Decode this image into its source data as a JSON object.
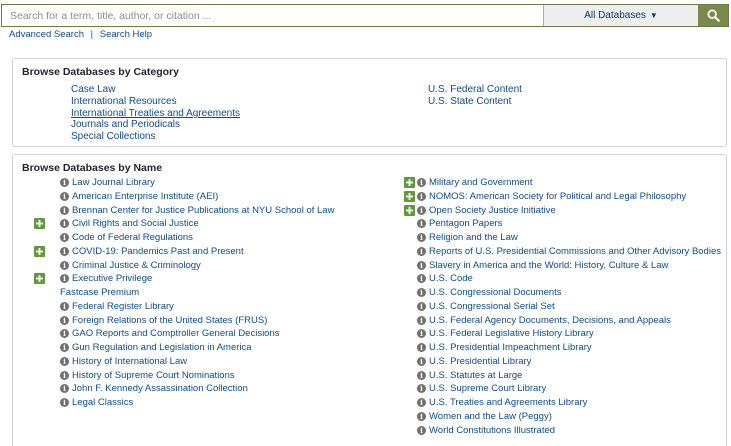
{
  "search": {
    "placeholder": "Search for a term, title, author, or citation ...",
    "database_select": "All Databases",
    "dropdown_glyph": "▼",
    "button_icon": "search-icon"
  },
  "sublinks": {
    "advanced": "Advanced Search",
    "separator": "|",
    "help": "Search Help"
  },
  "category_panel": {
    "title": "Browse Databases by Category",
    "left": [
      "Case Law",
      "International Resources",
      "International Treaties and Agreements",
      "Journals and Periodicals",
      "Special Collections"
    ],
    "right": [
      "U.S. Federal Content",
      "U.S. State Content"
    ]
  },
  "name_panel": {
    "title": "Browse Databases by Name",
    "left": [
      {
        "label": "Law Journal Library",
        "expandable": false,
        "info": true
      },
      {
        "label": "American Enterprise Institute (AEI)",
        "expandable": false,
        "info": true
      },
      {
        "label": "Brennan Center for Justice Publications at NYU School of Law",
        "expandable": false,
        "info": true
      },
      {
        "label": "Civil Rights and Social Justice",
        "expandable": true,
        "info": true
      },
      {
        "label": "Code of Federal Regulations",
        "expandable": false,
        "info": true
      },
      {
        "label": "COVID-19: Pandemics Past and Present",
        "expandable": true,
        "info": true
      },
      {
        "label": "Criminal Justice & Criminology",
        "expandable": false,
        "info": true
      },
      {
        "label": "Executive Privilege",
        "expandable": true,
        "info": true
      },
      {
        "label": "Fastcase Premium",
        "expandable": false,
        "info": false
      },
      {
        "label": "Federal Register Library",
        "expandable": false,
        "info": true
      },
      {
        "label": "Foreign Relations of the United States (FRUS)",
        "expandable": false,
        "info": true
      },
      {
        "label": "GAO Reports and Comptroller General Decisions",
        "expandable": false,
        "info": true
      },
      {
        "label": "Gun Regulation and Legislation in America",
        "expandable": false,
        "info": true
      },
      {
        "label": "History of International Law",
        "expandable": false,
        "info": true
      },
      {
        "label": "History of Supreme Court Nominations",
        "expandable": false,
        "info": true
      },
      {
        "label": "John F. Kennedy Assassination Collection",
        "expandable": false,
        "info": true
      },
      {
        "label": "Legal Classics",
        "expandable": false,
        "info": true
      }
    ],
    "right": [
      {
        "label": "Military and Government",
        "expandable": true,
        "info": true
      },
      {
        "label": "NOMOS: American Society for Political and Legal Philosophy",
        "expandable": true,
        "info": true
      },
      {
        "label": "Open Society Justice Initiative",
        "expandable": true,
        "info": true
      },
      {
        "label": "Pentagon Papers",
        "expandable": false,
        "info": true
      },
      {
        "label": "Religion and the Law",
        "expandable": false,
        "info": true
      },
      {
        "label": "Reports of U.S. Presidential Commissions and Other Advisory Bodies",
        "expandable": false,
        "info": true
      },
      {
        "label": "Slavery in America and the World: History, Culture & Law",
        "expandable": false,
        "info": true
      },
      {
        "label": "U.S. Code",
        "expandable": false,
        "info": true
      },
      {
        "label": "U.S. Congressional Documents",
        "expandable": false,
        "info": true
      },
      {
        "label": "U.S. Congressional Serial Set",
        "expandable": false,
        "info": true
      },
      {
        "label": "U.S. Federal Agency Documents, Decisions, and Appeals",
        "expandable": false,
        "info": true
      },
      {
        "label": "U.S. Federal Legislative History Library",
        "expandable": false,
        "info": true
      },
      {
        "label": "U.S. Presidential Impeachment Library",
        "expandable": false,
        "info": true
      },
      {
        "label": "U.S. Presidential Library",
        "expandable": false,
        "info": true
      },
      {
        "label": "U.S. Statutes at Large",
        "expandable": false,
        "info": true
      },
      {
        "label": "U.S. Supreme Court Library",
        "expandable": false,
        "info": true
      },
      {
        "label": "U.S. Treaties and Agreements Library",
        "expandable": false,
        "info": true
      },
      {
        "label": "Women and the Law (Peggy)",
        "expandable": false,
        "info": true
      },
      {
        "label": "World Constitutions Illustrated",
        "expandable": false,
        "info": true
      }
    ]
  },
  "colors": {
    "accent_green": "#7a8a4c",
    "expand_green": "#5f9a3c",
    "link_blue": "#0e4c8a",
    "info_gray": "#707070"
  }
}
